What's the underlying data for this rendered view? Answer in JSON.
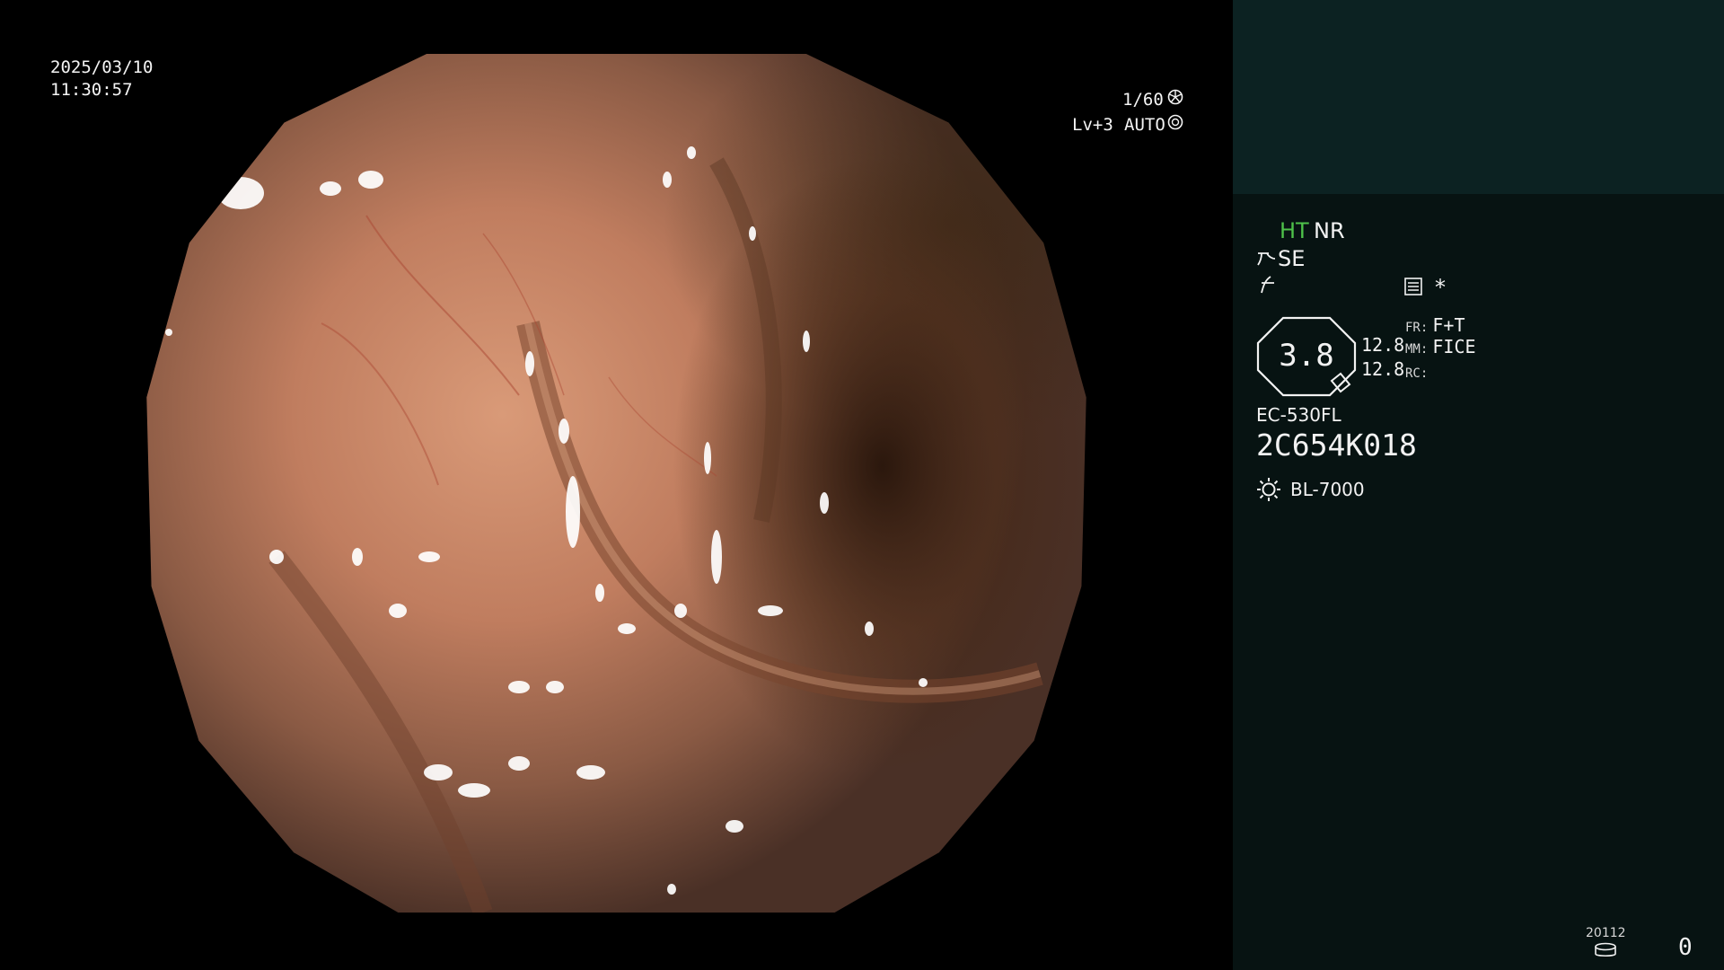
{
  "overlay": {
    "date": "2025/03/10",
    "time": "11:30:57",
    "shutter": "1/60",
    "level": "Lv+3",
    "iris_mode": "AUTO"
  },
  "panel": {
    "enhancement": {
      "ht": "HT",
      "nr": "NR",
      "se": "SE"
    },
    "zoom_value": "3.8",
    "zoom_sub_top": "12.8",
    "zoom_sub_bottom": "12.8",
    "params": [
      {
        "key": "FR:",
        "value": "F+T"
      },
      {
        "key": "MM:",
        "value": "FICE"
      },
      {
        "key": "RC:",
        "value": ""
      }
    ],
    "scope_model": "EC-530FL",
    "scope_serial": "2C654K018",
    "light_source": "BL-7000",
    "storage_count": "20112",
    "capture_count": "0",
    "asterisk": "*"
  },
  "colors": {
    "ht_green": "#4ec24a",
    "panel_bg": "#071312",
    "header_bg": "#0c2222"
  },
  "icons": [
    "shutter-icon",
    "iris-icon",
    "structure-icon",
    "freeze-icon",
    "menu-icon",
    "light-source-icon",
    "storage-icon",
    "zoom-tag-icon"
  ]
}
